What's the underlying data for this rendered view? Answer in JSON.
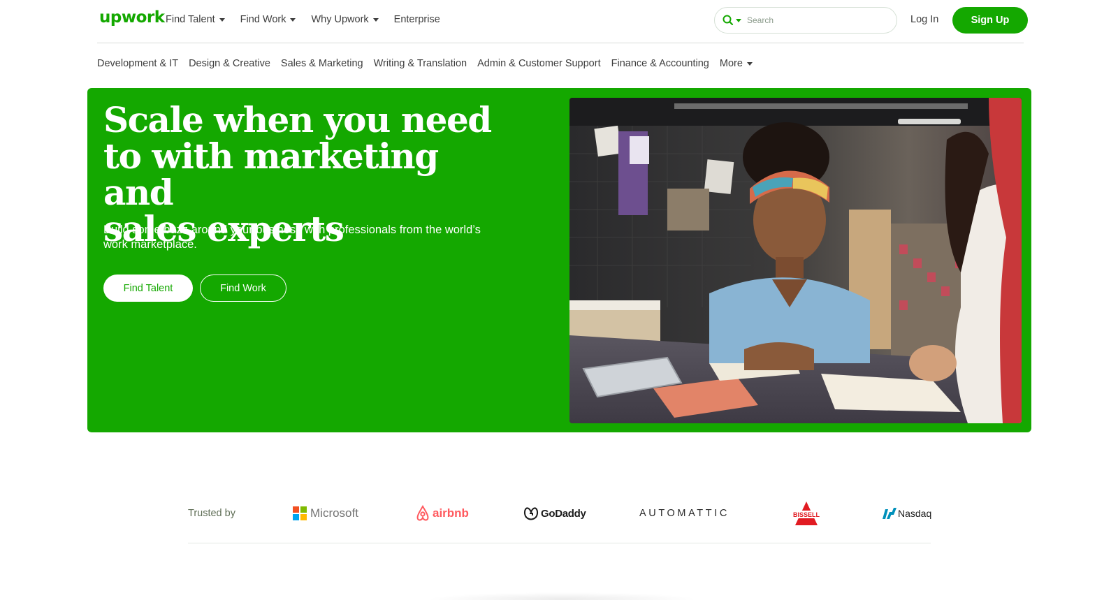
{
  "brand": {
    "name": "upwork",
    "color": "#14a800"
  },
  "header": {
    "nav": [
      {
        "label": "Find Talent",
        "dropdown": true
      },
      {
        "label": "Find Work",
        "dropdown": true
      },
      {
        "label": "Why Upwork",
        "dropdown": true
      },
      {
        "label": "Enterprise",
        "dropdown": false
      }
    ],
    "search_placeholder": "Search",
    "login_label": "Log In",
    "signup_label": "Sign Up"
  },
  "categories": [
    "Development & IT",
    "Design & Creative",
    "Sales & Marketing",
    "Writing & Translation",
    "Admin & Customer Support",
    "Finance & Accounting",
    "More"
  ],
  "hero": {
    "title_line1": "Scale when you need",
    "title_line2": "to with marketing and",
    "title_line3": "sales experts",
    "subtitle": "Build some buzz around your business with professionals from the world’s work marketplace.",
    "primary_button": "Find Talent",
    "secondary_button": "Find Work",
    "background_color": "#14a800"
  },
  "trusted": {
    "label": "Trusted by",
    "logos": [
      "Microsoft",
      "airbnb",
      "GoDaddy",
      "AUTOMATTIC",
      "BISSELL",
      "Nasdaq"
    ]
  }
}
